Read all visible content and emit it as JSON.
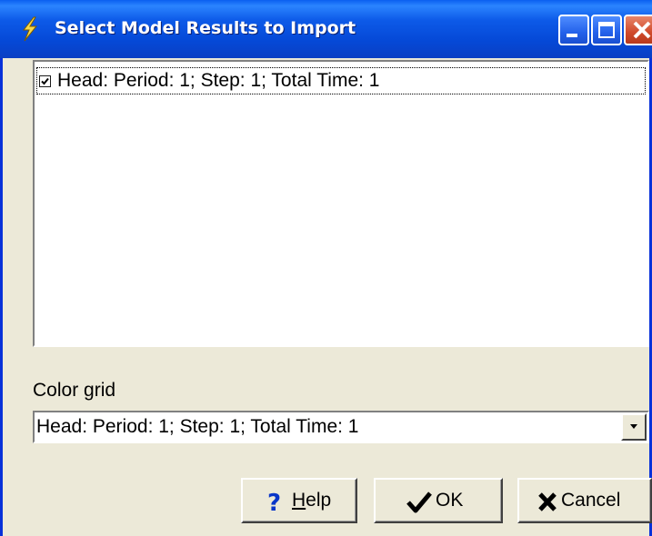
{
  "window": {
    "title": "Select Model Results to Import",
    "icons": [
      "lightning-icon",
      "minimize-icon",
      "maximize-icon",
      "close-icon"
    ],
    "colors": {
      "titlebar": "#0549d7",
      "frame": "#0831d9",
      "dialog_bg": "#ece9d8"
    }
  },
  "results_list": {
    "items": [
      {
        "label": "Head: Period: 1; Step: 1; Total Time: 1",
        "checked": true
      }
    ]
  },
  "color_grid": {
    "label": "Color grid",
    "selected": "Head: Period: 1; Step: 1; Total Time: 1"
  },
  "buttons": {
    "help": {
      "label_first": "H",
      "label_rest": "elp",
      "icon": "help-question-icon",
      "icon_color": "#0a36c8"
    },
    "ok": {
      "label": "OK",
      "icon": "checkmark-icon"
    },
    "cancel": {
      "label": "Cancel",
      "icon": "x-mark-icon"
    }
  }
}
